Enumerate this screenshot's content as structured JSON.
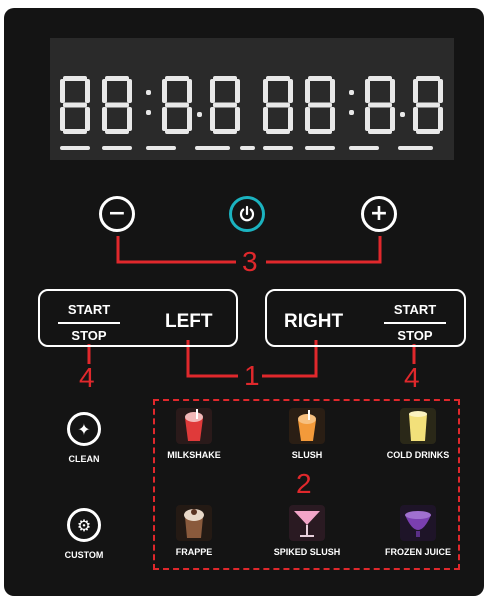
{
  "display": {
    "segment_color": "#e8e8e8",
    "background": "#2a2a2a"
  },
  "top_controls": {
    "minus": {
      "icon": "minus-icon",
      "glyph": "−"
    },
    "power": {
      "icon": "power-icon",
      "color": "#1bb3c0"
    },
    "plus": {
      "icon": "plus-icon",
      "glyph": "+"
    }
  },
  "left_controls": {
    "start_label": "START",
    "stop_label": "STOP",
    "side_label": "LEFT"
  },
  "right_controls": {
    "start_label": "START",
    "stop_label": "STOP",
    "side_label": "RIGHT"
  },
  "callouts": {
    "top": "3",
    "middle": "1",
    "left": "4",
    "right": "4",
    "modes": "2",
    "color": "#e0282c"
  },
  "utility_buttons": [
    {
      "label": "CLEAN",
      "icon": "sparkle-icon"
    },
    {
      "label": "CUSTOM",
      "icon": "gear-icon"
    }
  ],
  "modes": [
    {
      "label": "MILKSHAKE",
      "icon": "milkshake-icon",
      "color": "#e03a3a"
    },
    {
      "label": "SLUSH",
      "icon": "slush-icon",
      "color": "#f39a3a"
    },
    {
      "label": "COLD DRINKS",
      "icon": "cold-drinks-icon",
      "color": "#f2e07a"
    },
    {
      "label": "FRAPPE",
      "icon": "frappe-icon",
      "color": "#8a5a3c"
    },
    {
      "label": "SPIKED SLUSH",
      "icon": "spiked-slush-icon",
      "color": "#f2a5c8"
    },
    {
      "label": "FROZEN JUICE",
      "icon": "frozen-juice-icon",
      "color": "#7a3fb0"
    }
  ]
}
